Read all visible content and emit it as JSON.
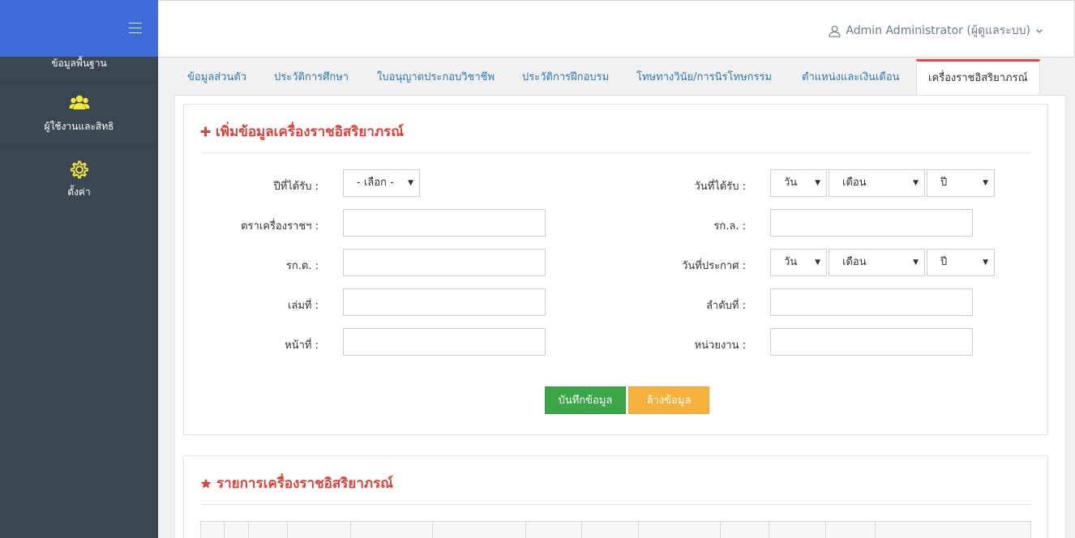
{
  "sidebar": {
    "menu_icon": "hamburger-icon",
    "items": [
      {
        "label": "ข้อมูลพื้นฐาน",
        "icon": ""
      },
      {
        "label": "ผู้ใช้งานและสิทธิ",
        "icon": "users-icon"
      },
      {
        "label": "ตั้งค่า",
        "icon": "gear-icon"
      }
    ],
    "accent": "#3d6bd8",
    "icon_color": "#f4e93a"
  },
  "header": {
    "user_label": "Admin Administrator (ผู้ดูแลระบบ)",
    "user_icon": "user-icon",
    "dropdown_icon": "chevron-down-icon"
  },
  "tabs": [
    {
      "label": "ข้อมูลส่วนตัว",
      "active": false
    },
    {
      "label": "ประวัติการศึกษา",
      "active": false
    },
    {
      "label": "ใบอนุญาตประกอบวิชาชีพ",
      "active": false
    },
    {
      "label": "ประวัติการฝึกอบรม",
      "active": false
    },
    {
      "label": "โทษทางวินัย/การนิรโทษกรรม",
      "active": false
    },
    {
      "label": "ตำแหน่งและเงินเดือน",
      "active": false
    },
    {
      "label": "เครื่องราชอิสริยาภรณ์",
      "active": true
    }
  ],
  "form": {
    "title": "เพิ่มข้อมูลเครื่องราชอิสริยาภรณ์",
    "title_icon": "plus-icon",
    "year_received_label": "ปีที่ได้รับ :",
    "year_select_value": "- เลือก -",
    "date_received_label": "วันที่ได้รับ :",
    "day_value": "วัน",
    "month_value": "เดือน",
    "year_value": "ปี",
    "insignia_label": "ตราเครื่องราชฯ :",
    "rkl_label": "รก.ล. :",
    "rkt_label": "รก.ต. :",
    "announce_date_label": "วันที่ประกาศ :",
    "volume_label": "เล่มที่ :",
    "order_label": "ลำดับที่ :",
    "page_label": "หน้าที่ :",
    "unit_label": "หน่วยงาน :",
    "save_label": "บันทึกข้อมูล",
    "clear_label": "ล้างข้อมูล"
  },
  "list": {
    "title": "รายการเครื่องราชอิสริยาภรณ์",
    "title_icon": "star-icon"
  },
  "colors": {
    "title_red": "#d9433b",
    "link_blue": "#2a7ab8",
    "save_green": "#3aa648",
    "clear_orange": "#f5b13c"
  }
}
